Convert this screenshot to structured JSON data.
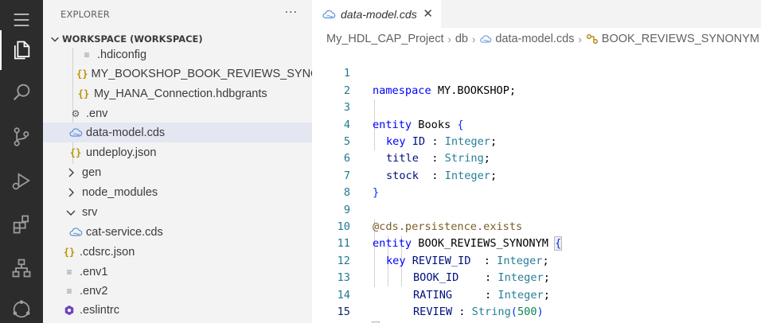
{
  "explorer": {
    "title": "EXPLORER",
    "more": "···",
    "workspace_label": "WORKSPACE (WORKSPACE)",
    "items": [
      {
        "label": ".hdiconfig",
        "icon": "lines-icon"
      },
      {
        "label": "MY_BOOKSHOP_BOOK_REVIEWS_SYNO...",
        "icon": "json-braces-icon"
      },
      {
        "label": "My_HANA_Connection.hdbgrants",
        "icon": "json-braces-icon"
      },
      {
        "label": ".env",
        "icon": "gear-icon"
      },
      {
        "label": "data-model.cds",
        "icon": "cds-cloud-icon",
        "selected": true
      },
      {
        "label": "undeploy.json",
        "icon": "json-braces-icon"
      },
      {
        "label": "gen",
        "icon": "chevron-right-icon"
      },
      {
        "label": "node_modules",
        "icon": "chevron-right-icon"
      },
      {
        "label": "srv",
        "icon": "chevron-down-icon"
      },
      {
        "label": "cat-service.cds",
        "icon": "cds-cloud-icon"
      },
      {
        "label": ".cdsrc.json",
        "icon": "json-braces-icon"
      },
      {
        "label": ".env1",
        "icon": "lines-icon"
      },
      {
        "label": ".env2",
        "icon": "lines-icon"
      },
      {
        "label": ".eslintrc",
        "icon": "eslint-icon"
      }
    ]
  },
  "editor": {
    "tab_label": "data-model.cds",
    "breadcrumb": [
      "My_HDL_CAP_Project",
      "db",
      "data-model.cds",
      "BOOK_REVIEWS_SYNONYM"
    ],
    "current_line": 15,
    "lines": [
      {
        "n": "1"
      },
      {
        "n": "2"
      },
      {
        "n": "3"
      },
      {
        "n": "4"
      },
      {
        "n": "5"
      },
      {
        "n": "6"
      },
      {
        "n": "7"
      },
      {
        "n": "8"
      },
      {
        "n": "9"
      },
      {
        "n": "10"
      },
      {
        "n": "11"
      },
      {
        "n": "12"
      },
      {
        "n": "13"
      },
      {
        "n": "14"
      },
      {
        "n": "15"
      }
    ],
    "tokens": {
      "l1_kw": "namespace",
      "l1_rest": " MY.BOOKSHOP;",
      "l3_kw": "entity",
      "l3_name": " Books ",
      "l3_br": "{",
      "l4_kw": "key",
      "l4_name": " ID ",
      "l4_colon": ": ",
      "l4_type": "Integer",
      "l4_end": ";",
      "l5_name": "title  ",
      "l5_colon": ": ",
      "l5_type": "String",
      "l5_end": ";",
      "l6_name": "stock  ",
      "l6_colon": ": ",
      "l6_type": "Integer",
      "l6_end": ";",
      "l7_br": "}",
      "l9_an": "@cds.persistence.exists",
      "l10_kw": "entity",
      "l10_name": " BOOK_REVIEWS_SYNONYM ",
      "l10_br": "{",
      "l11_kw": "key",
      "l11_name": " REVIEW_ID  ",
      "l11_colon": ": ",
      "l11_type": "Integer",
      "l11_end": ";",
      "l12_name": "BOOK_ID    ",
      "l12_colon": ": ",
      "l12_type": "Integer",
      "l12_end": ";",
      "l13_name": "RATING     ",
      "l13_colon": ": ",
      "l13_type": "Integer",
      "l13_end": ";",
      "l14_name": "REVIEW ",
      "l14_colon": ": ",
      "l14_type": "String",
      "l14_paren": "(",
      "l14_num": "500",
      "l14_close": ")",
      "l15_br": "}"
    }
  },
  "colors": {
    "activity_bar": "#2c2c2c",
    "sidebar": "#f3f3f3",
    "selection": "#e4e6f1",
    "keyword": "#0000ff",
    "type": "#267f99"
  }
}
